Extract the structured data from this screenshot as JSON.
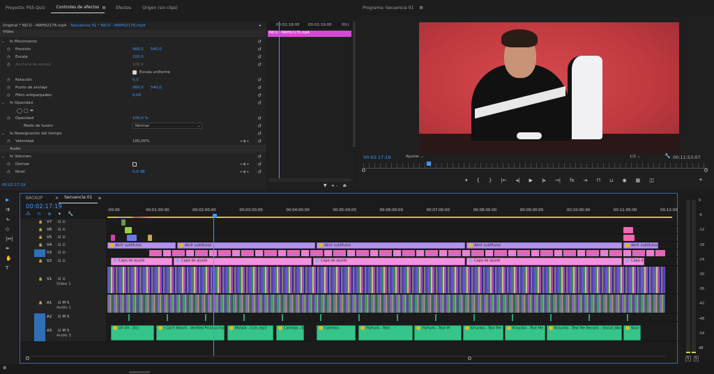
{
  "effect_tabs": [
    "Proyecto: PS5 Quiz",
    "Controles de efectos",
    "Efectos",
    "Origen (sin clips)"
  ],
  "program_title": "Programa: Secuencia 01",
  "clip_header": {
    "source": "Original * NICO - MAH02176.mp4",
    "sequence": "Secuencia 01 * NICO - MAH02176.mp4"
  },
  "mini_ruler": [
    "00:02:18:00",
    "00:02:19:00",
    "00:("
  ],
  "mini_clip": "NICO - MAH02176.mp4",
  "sections": {
    "video": "Vídeo",
    "audio": "Audio"
  },
  "params": [
    {
      "label": "fx  Movimiento",
      "v1": "",
      "v2": ""
    },
    {
      "label": "Posición",
      "v1": "960,0",
      "v2": "540,0"
    },
    {
      "label": "Escala",
      "v1": "100,0",
      "v2": ""
    },
    {
      "label": "Anchura de escala",
      "v1": "100,0",
      "v2": ""
    },
    {
      "label": "Escala uniforme",
      "v1": "",
      "v2": ""
    },
    {
      "label": "Rotación",
      "v1": "0,0",
      "v2": ""
    },
    {
      "label": "Punto de anclaje",
      "v1": "960,0",
      "v2": "540,0"
    },
    {
      "label": "Filtro antiparpadeo",
      "v1": "0,00",
      "v2": ""
    },
    {
      "label": "fx  Opacidad",
      "v1": "",
      "v2": ""
    },
    {
      "label": "",
      "v1": "",
      "v2": ""
    },
    {
      "label": "Opacidad",
      "v1": "100,0 %",
      "v2": ""
    },
    {
      "label": "Modo de fusión",
      "v1": "Normal",
      "v2": ""
    },
    {
      "label": "fx  Reasignación del tiempo",
      "v1": "",
      "v2": ""
    },
    {
      "label": "Velocidad",
      "v1": "100,00%",
      "v2": ""
    },
    {
      "label": "Audio",
      "v1": "",
      "v2": ""
    },
    {
      "label": "fx  Volumen",
      "v1": "",
      "v2": ""
    },
    {
      "label": "Derivar",
      "v1": "",
      "v2": ""
    },
    {
      "label": "Nivel",
      "v1": "0,0 dB",
      "v2": ""
    }
  ],
  "ec_timecode": "00:02:17:19",
  "program": {
    "timecode": "00:02:17:19",
    "fit": "Ajustar",
    "quality": "1/2",
    "duration": "00:11:53:07"
  },
  "timeline_tabs": [
    "BACKUP",
    "Secuencia 01"
  ],
  "timeline_timecode": "00:02:17:19",
  "ruler": [
    ":00:00",
    "00:01:00:00",
    "00:02:00:00",
    "00:03:00:00",
    "00:04:00:00",
    "00:05:00:00",
    "00:06:00:00",
    "00:07:00:00",
    "00:08:00:00",
    "00:09:00:00",
    "00:10:00:00",
    "00:11:00:00",
    "00:12:00"
  ],
  "tracks": [
    {
      "name": "V7",
      "label": ""
    },
    {
      "name": "V6",
      "label": ""
    },
    {
      "name": "V5",
      "label": ""
    },
    {
      "name": "V4",
      "label": ""
    },
    {
      "name": "V3",
      "label": ""
    },
    {
      "name": "V2",
      "label": ""
    },
    {
      "name": "V1",
      "label": "Vídeo 1"
    },
    {
      "name": "A1",
      "label": "Audio 1"
    },
    {
      "name": "A2",
      "label": ""
    },
    {
      "name": "A3",
      "label": "Audio 3"
    }
  ],
  "v4_clips": [
    "Abrir subtítulos",
    "Abrir subtítulos",
    "Abrir subtítulos",
    "Abrir subtítulos",
    "Abrir subtítulos"
  ],
  "v2_clips": [
    "Capa de ajuste",
    "Capa de ajuste",
    "Capa de ajuste",
    "Capa de ajuste",
    "Capa de ajuste",
    "Capa de ajuste"
  ],
  "music_clips": [
    "Uh Oh - Dcc",
    "I Can't Reach - Verified Picasso.mp3",
    "Motala - Cctc.mp3",
    "Calimba - E",
    "Calimba -",
    "FlyFunk - Text",
    "FlyFunk - Text M",
    "Kriuckia - Text Me",
    "Kriuckia - Text Me Recd",
    "Kriuckia - Text Me Record... Social_Wom m",
    "Sour"
  ],
  "meter_scale": [
    "0",
    "-6",
    "-12",
    "-18",
    "-24",
    "-30",
    "-36",
    "-42",
    "-48",
    "-54",
    "dB"
  ],
  "meter_solo": [
    "S",
    "S"
  ]
}
